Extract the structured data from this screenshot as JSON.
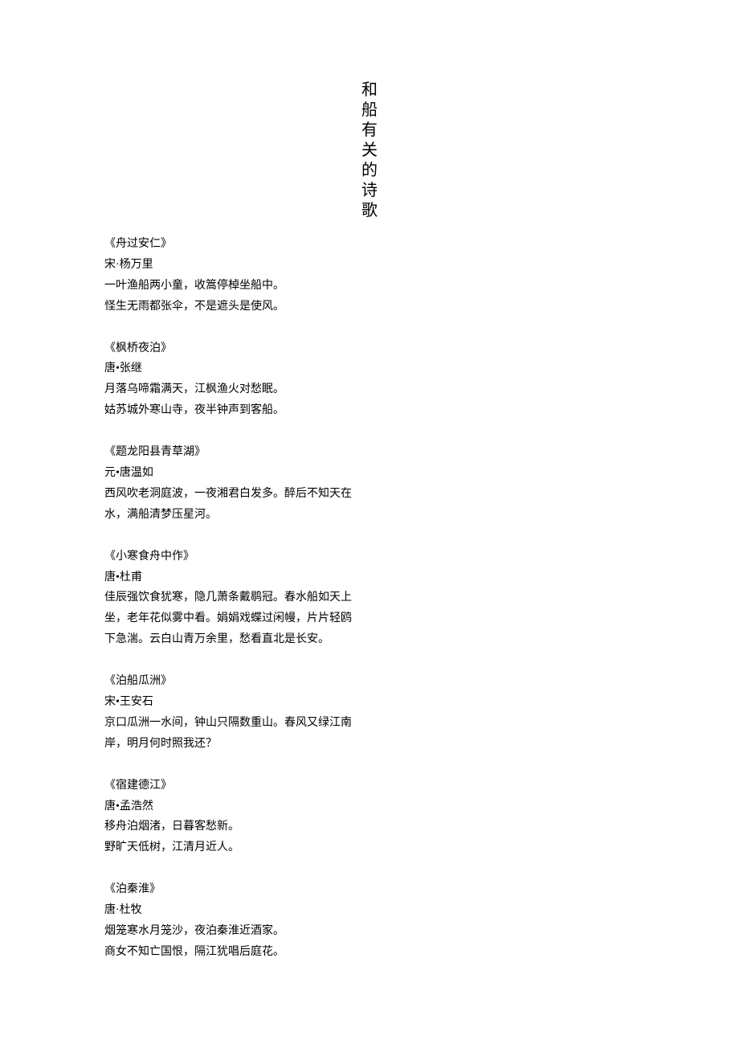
{
  "title": "和船有关的诗歌",
  "poems": [
    {
      "title": "《舟过安仁》",
      "author": "宋·杨万里",
      "body": "一叶渔船两小童，收篙停棹坐船中。\n怪生无雨都张伞，不是遮头是使风。"
    },
    {
      "title": "《枫桥夜泊》",
      "author": "唐•张继",
      "body": "月落乌啼霜满天，江枫渔火对愁眠。\n姑苏城外寒山寺，夜半钟声到客船。"
    },
    {
      "title": "《题龙阳县青草湖》",
      "author": "元•唐温如",
      "body": "西风吹老洞庭波，一夜湘君白发多。醉后不知天在水，满船清梦压星河。"
    },
    {
      "title": "《小寒食舟中作》",
      "author": "唐•杜甫",
      "body": "佳辰强饮食犹寒，隐几萧条戴鹖冠。春水船如天上坐，老年花似雾中看。娟娟戏蝶过闲幔，片片轻鸥下急湍。云白山青万余里，愁看直北是长安。"
    },
    {
      "title": "《泊船瓜洲》",
      "author": "宋•王安石",
      "body": "京口瓜洲一水间，钟山只隔数重山。春风又绿江南岸，明月何时照我还？"
    },
    {
      "title": "《宿建德江》",
      "author": "唐•孟浩然",
      "body": "移舟泊烟渚，日暮客愁新。\n野旷天低树，江清月近人。"
    },
    {
      "title": "《泊秦淮》",
      "author": "唐·杜牧",
      "body": "烟笼寒水月笼沙，夜泊秦淮近酒家。\n商女不知亡国恨，隔江犹唱后庭花。"
    }
  ]
}
